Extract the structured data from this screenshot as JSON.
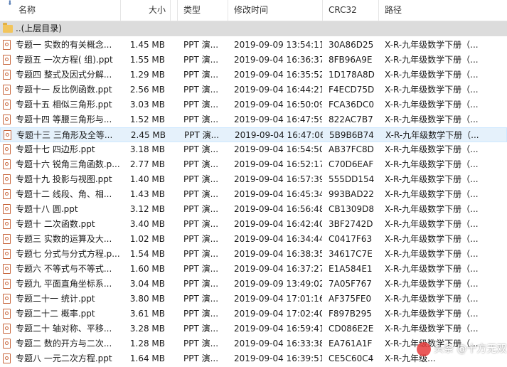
{
  "columns": {
    "name": "名称",
    "size": "大小",
    "type": "类型",
    "modified": "修改时间",
    "crc": "CRC32",
    "path": "路径"
  },
  "parent_row": {
    "label": "..(上层目录)"
  },
  "files": [
    {
      "name": "专题一 实数的有关概念...",
      "size": "1.45 MB",
      "type": "PPT 演...",
      "modified": "2019-09-09 13:54:11",
      "crc": "30A86D25",
      "path": "X-R-九年级数学下册（..."
    },
    {
      "name": "专题五 一次方程( 组).ppt",
      "size": "1.55 MB",
      "type": "PPT 演...",
      "modified": "2019-09-04 16:36:37",
      "crc": "8FB96A9E",
      "path": "X-R-九年级数学下册（..."
    },
    {
      "name": "专题四 整式及因式分解...",
      "size": "1.29 MB",
      "type": "PPT 演...",
      "modified": "2019-09-04 16:35:52",
      "crc": "1D178A8D",
      "path": "X-R-九年级数学下册（..."
    },
    {
      "name": "专题十一 反比例函数.ppt",
      "size": "2.56 MB",
      "type": "PPT 演...",
      "modified": "2019-09-04 16:44:21",
      "crc": "F4ECD75D",
      "path": "X-R-九年级数学下册（..."
    },
    {
      "name": "专题十五 相似三角形.ppt",
      "size": "3.03 MB",
      "type": "PPT 演...",
      "modified": "2019-09-04 16:50:09",
      "crc": "FCA36DC0",
      "path": "X-R-九年级数学下册（..."
    },
    {
      "name": "专题十四 等腰三角形与...",
      "size": "1.52 MB",
      "type": "PPT 演...",
      "modified": "2019-09-04 16:47:59",
      "crc": "822AC7B7",
      "path": "X-R-九年级数学下册（..."
    },
    {
      "name": "专题十三 三角形及全等...",
      "size": "2.45 MB",
      "type": "PPT 演...",
      "modified": "2019-09-04 16:47:06",
      "crc": "5B9B6B74",
      "path": "X-R-九年级数学下册（..."
    },
    {
      "name": "专题十七 四边形.ppt",
      "size": "3.18 MB",
      "type": "PPT 演...",
      "modified": "2019-09-04 16:54:50",
      "crc": "AB37FC8D",
      "path": "X-R-九年级数学下册（..."
    },
    {
      "name": "专题十六 锐角三角函数.p...",
      "size": "2.77 MB",
      "type": "PPT 演...",
      "modified": "2019-09-04 16:52:17",
      "crc": "C70D6EAF",
      "path": "X-R-九年级数学下册（..."
    },
    {
      "name": "专题十九 投影与视图.ppt",
      "size": "1.40 MB",
      "type": "PPT 演...",
      "modified": "2019-09-04 16:57:39",
      "crc": "555DD154",
      "path": "X-R-九年级数学下册（..."
    },
    {
      "name": "专题十二 线段、角、相...",
      "size": "1.43 MB",
      "type": "PPT 演...",
      "modified": "2019-09-04 16:45:34",
      "crc": "993BAD22",
      "path": "X-R-九年级数学下册（..."
    },
    {
      "name": "专题十八 圆.ppt",
      "size": "3.12 MB",
      "type": "PPT 演...",
      "modified": "2019-09-04 16:56:48",
      "crc": "CB1309D8",
      "path": "X-R-九年级数学下册（..."
    },
    {
      "name": "专题十 二次函数.ppt",
      "size": "3.40 MB",
      "type": "PPT 演...",
      "modified": "2019-09-04 16:42:40",
      "crc": "3BF2742D",
      "path": "X-R-九年级数学下册（..."
    },
    {
      "name": "专题三 实数的运算及大...",
      "size": "1.02 MB",
      "type": "PPT 演...",
      "modified": "2019-09-04 16:34:44",
      "crc": "C0417F63",
      "path": "X-R-九年级数学下册（..."
    },
    {
      "name": "专题七 分式与分式方程.p...",
      "size": "1.54 MB",
      "type": "PPT 演...",
      "modified": "2019-09-04 16:38:35",
      "crc": "34617C7E",
      "path": "X-R-九年级数学下册（..."
    },
    {
      "name": "专题六 不等式与不等式...",
      "size": "1.60 MB",
      "type": "PPT 演...",
      "modified": "2019-09-04 16:37:27",
      "crc": "E1A584E1",
      "path": "X-R-九年级数学下册（..."
    },
    {
      "name": "专题九 平面直角坐标系...",
      "size": "3.04 MB",
      "type": "PPT 演...",
      "modified": "2019-09-09 13:49:02",
      "crc": "7A05F767",
      "path": "X-R-九年级数学下册（..."
    },
    {
      "name": "专题二十一 统计.ppt",
      "size": "3.80 MB",
      "type": "PPT 演...",
      "modified": "2019-09-04 17:01:16",
      "crc": "AF375FE0",
      "path": "X-R-九年级数学下册（..."
    },
    {
      "name": "专题二十二 概率.ppt",
      "size": "3.61 MB",
      "type": "PPT 演...",
      "modified": "2019-09-04 17:02:40",
      "crc": "F897B295",
      "path": "X-R-九年级数学下册（..."
    },
    {
      "name": "专题二十 轴对称、平移...",
      "size": "3.28 MB",
      "type": "PPT 演...",
      "modified": "2019-09-04 16:59:41",
      "crc": "CD086E2E",
      "path": "X-R-九年级数学下册（..."
    },
    {
      "name": "专题二 数的开方与二次...",
      "size": "1.28 MB",
      "type": "PPT 演...",
      "modified": "2019-09-04 16:33:38",
      "crc": "EA761A1F",
      "path": "X-R-九年级数学下册（..."
    },
    {
      "name": "专题八 一元二次方程.ppt",
      "size": "1.64 MB",
      "type": "PPT 演...",
      "modified": "2019-09-04 16:39:51",
      "crc": "CE5C60C4",
      "path": "X-R-九年级..."
    }
  ],
  "selected_index": 6,
  "watermark": "头条 @十方无双",
  "colors": {
    "selection": "#e5f1fb",
    "parent_row": "#dcdcdc",
    "ppt_icon": "#c7643a",
    "folder_icon": "#f2c55c"
  }
}
